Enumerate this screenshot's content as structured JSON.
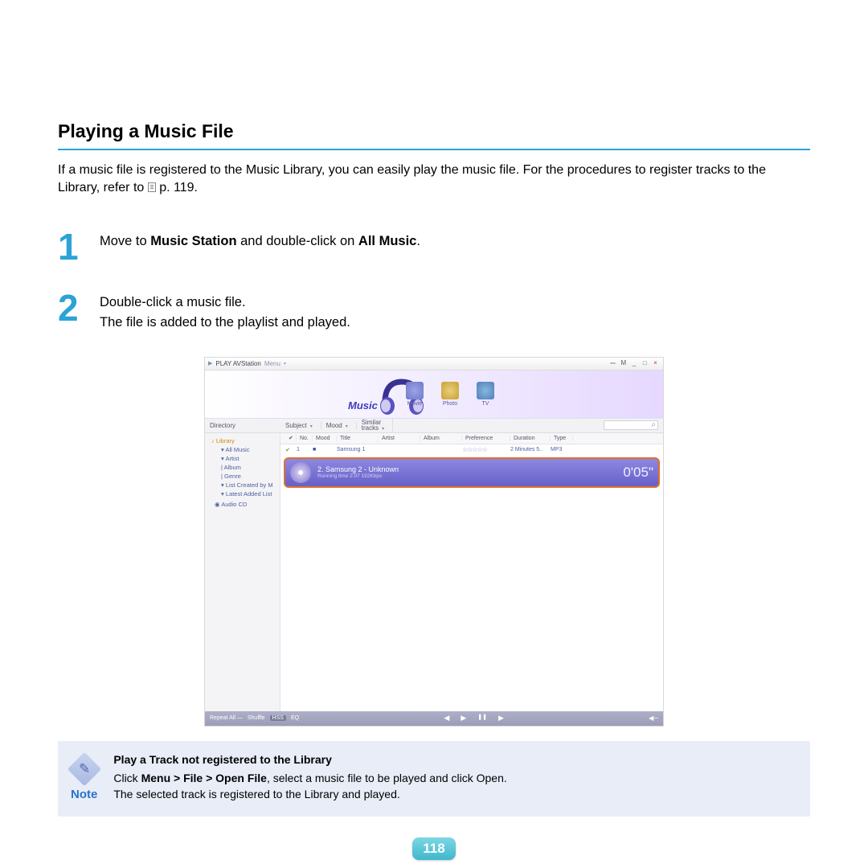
{
  "heading": "Playing a Music File",
  "intro_a": "If a music file is registered to the Music Library, you can easily play the music file. For the procedures to register tracks to the Library, refer to ",
  "intro_b": " p. 119.",
  "steps": {
    "s1_num": "1",
    "s1_a": "Move to ",
    "s1_b": "Music Station",
    "s1_c": " and double-click on ",
    "s1_d": "All Music",
    "s1_e": ".",
    "s2_num": "2",
    "s2_a": "Double-click a music file.",
    "s2_b": "The file is added to the playlist and played."
  },
  "app": {
    "title_a": "PLAY AVStation",
    "title_b": "Menu",
    "win": {
      "a": "⎓",
      "b": "M",
      "c": "_",
      "d": "□",
      "e": "×"
    },
    "music_label": "Music",
    "nav": {
      "movie": "Movie",
      "photo": "Photo",
      "tv": "TV"
    },
    "tabs": {
      "directory": "Directory",
      "subject": "Subject",
      "mood": "Mood",
      "similar": "Similar\ntracks"
    },
    "sidebar": {
      "root": "Library",
      "allmusic": "All Music",
      "artist": "Artist",
      "album": "Album",
      "genre": "Genre",
      "listcreated": "List Created by M",
      "latest": "Latest Added List",
      "audiocd": "Audio CD"
    },
    "cols": {
      "chk": "✔",
      "no": "No.",
      "mood": "Mood",
      "title": "Title",
      "artist": "Artist",
      "album": "Album",
      "pref": "Preference",
      "dur": "Duration",
      "type": "Type"
    },
    "row1": {
      "no": "1",
      "mood": "■",
      "title": "Samsung 1",
      "stars": "☆☆☆☆☆",
      "dur": "2 Minutes 5..",
      "type": "MP3"
    },
    "nowplaying": {
      "title": "2. Samsung 2 - Unknown",
      "sub": "Running time 2:07     192Kbps",
      "time": "0'05\""
    },
    "playbar": {
      "repeat": "Repeat All —",
      "shuffle": "Shuffle",
      "hss": "HSS",
      "eq": "EQ",
      "prev": "◀",
      "play": "▶",
      "pause": "❚❚",
      "next": "▶",
      "vol": "◀─"
    }
  },
  "note": {
    "label": "Note",
    "title": "Play a Track not registered to the Library",
    "line1_a": "Click ",
    "line1_b": "Menu > File > Open File",
    "line1_c": ", select a music file to be played and click Open.",
    "line2": "The selected track is registered to the Library and played."
  },
  "page_number": "118"
}
